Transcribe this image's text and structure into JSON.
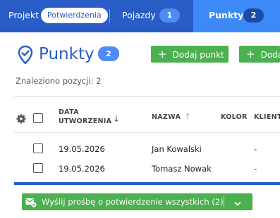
{
  "topbar": {
    "project_label": "Projekt",
    "project_pill": "Potwierdzenia",
    "tabs": [
      {
        "label": "Pojazdy",
        "badge": "1"
      },
      {
        "label": "Punkty",
        "badge": "2",
        "active": true
      }
    ]
  },
  "page": {
    "title": "Punkty",
    "count_badge": "2",
    "icon": "map-pin-check-icon",
    "buttons": [
      {
        "label": "Dodaj punkt",
        "icon": "plus-icon"
      },
      {
        "label": "Dodaj",
        "icon": "plus-icon"
      }
    ],
    "found_text": "Znaleziono pozycji: 2"
  },
  "table": {
    "headers": [
      {
        "line1": "DATA",
        "line2": "UTWORZENIA",
        "sort": "desc"
      },
      {
        "line1": "NAZWA",
        "sort": "asc"
      },
      {
        "line1": "KOLOR"
      },
      {
        "line1": "KLIENT"
      }
    ],
    "rows": [
      {
        "date": "19.05.2026",
        "name": "Jan Kowalski",
        "client": "-"
      },
      {
        "date": "19.05.2026",
        "name": "Tomasz Nowak",
        "client": "-"
      }
    ]
  },
  "footer": {
    "button_label": "Wyślij prośbę o potwierdzenie wszystkich (2)",
    "icon": "mail-check-icon",
    "dropdown_icon": "chevron-down-icon"
  },
  "colors": {
    "primary": "#2a5cc6",
    "active_tab": "#3d8af7",
    "badge": "#4d8bf5",
    "success": "#4caf50"
  }
}
